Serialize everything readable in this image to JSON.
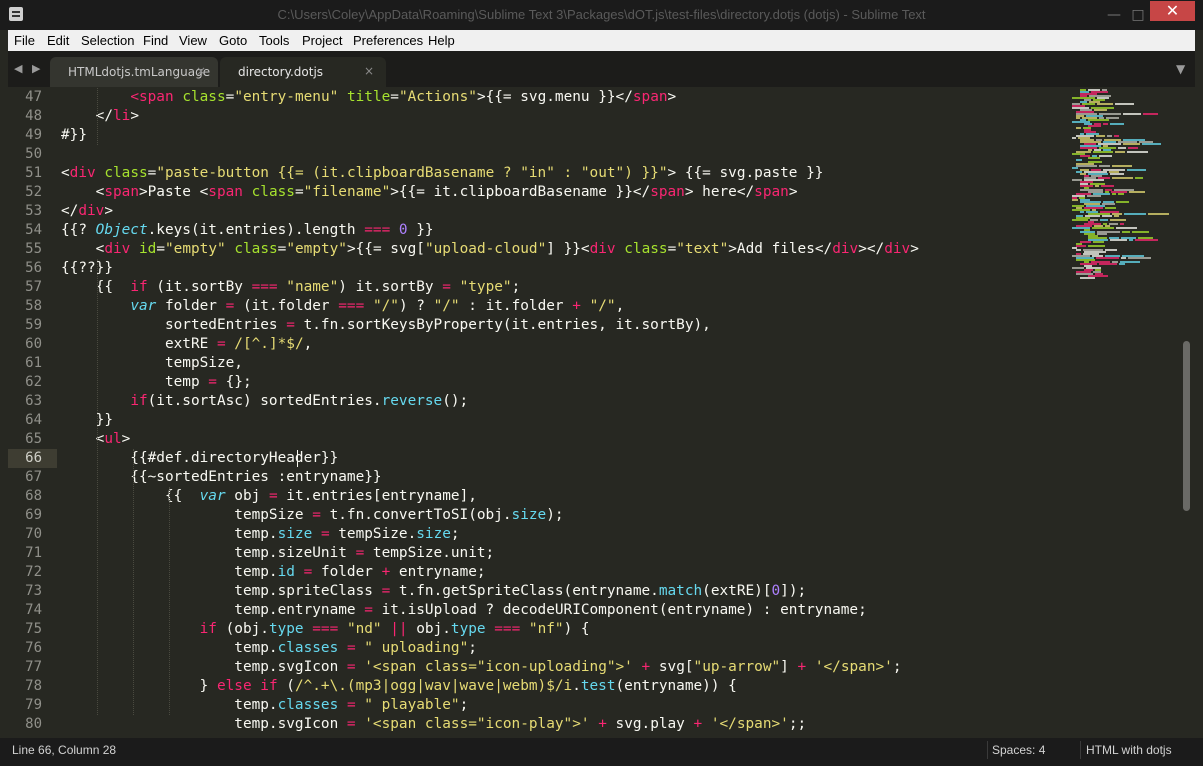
{
  "window": {
    "title": "C:\\Users\\Coley\\AppData\\Roaming\\Sublime Text 3\\Packages\\dOT.js\\test-files\\directory.dotjs (dotjs) - Sublime Text",
    "close_glyph": "✕",
    "min_glyph": "—",
    "max_glyph": "□"
  },
  "menu": [
    "File",
    "Edit",
    "Selection",
    "Find",
    "View",
    "Goto",
    "Tools",
    "Project",
    "Preferences",
    "Help"
  ],
  "tabs": [
    {
      "label": "HTMLdotjs.tmLanguage",
      "close": "×",
      "active": false
    },
    {
      "label": "directory.dotjs",
      "close": "×",
      "active": true
    }
  ],
  "tabbar": {
    "nav_left": "◀",
    "nav_right": "▶",
    "dropdown": "▼"
  },
  "editor": {
    "current_line": 66,
    "lines": [
      {
        "n": 47,
        "tokens": [
          [
            "        ",
            ""
          ],
          [
            "<",
            "tag"
          ],
          [
            "span",
            "tag"
          ],
          [
            " ",
            ""
          ],
          [
            "class",
            "attr"
          ],
          [
            "=",
            ""
          ],
          [
            "\"entry-menu\"",
            "str"
          ],
          [
            " ",
            ""
          ],
          [
            "title",
            "attr"
          ],
          [
            "=",
            ""
          ],
          [
            "\"Actions\"",
            "str"
          ],
          [
            ">{{= svg.menu }}</",
            ""
          ],
          [
            "span",
            "tag"
          ],
          [
            ">",
            ""
          ]
        ]
      },
      {
        "n": 48,
        "tokens": [
          [
            "    </",
            ""
          ],
          [
            "li",
            "tag"
          ],
          [
            ">",
            ""
          ]
        ]
      },
      {
        "n": 49,
        "tokens": [
          [
            "#}}",
            ""
          ]
        ]
      },
      {
        "n": 50,
        "tokens": [
          [
            "",
            ""
          ]
        ]
      },
      {
        "n": 51,
        "tokens": [
          [
            "<",
            ""
          ],
          [
            "div",
            "tag"
          ],
          [
            " ",
            ""
          ],
          [
            "class",
            "attr"
          ],
          [
            "=",
            ""
          ],
          [
            "\"paste-button {{= (it.clipboardBasename ? \"in\" : \"out\") }}\"",
            "str"
          ],
          [
            "> {{= svg.paste }}",
            ""
          ]
        ]
      },
      {
        "n": 52,
        "tokens": [
          [
            "    <",
            ""
          ],
          [
            "span",
            "tag"
          ],
          [
            ">Paste <",
            ""
          ],
          [
            "span",
            "tag"
          ],
          [
            " ",
            ""
          ],
          [
            "class",
            "attr"
          ],
          [
            "=",
            ""
          ],
          [
            "\"filename\"",
            "str"
          ],
          [
            ">{{= it.clipboardBasename }}</",
            ""
          ],
          [
            "span",
            "tag"
          ],
          [
            "> here</",
            ""
          ],
          [
            "span",
            "tag"
          ],
          [
            ">",
            ""
          ]
        ]
      },
      {
        "n": 53,
        "tokens": [
          [
            "</",
            ""
          ],
          [
            "div",
            "tag"
          ],
          [
            ">",
            ""
          ]
        ]
      },
      {
        "n": 54,
        "tokens": [
          [
            "{{? ",
            ""
          ],
          [
            "Object",
            "obj"
          ],
          [
            ".keys(it.entries).length ",
            ""
          ],
          [
            "===",
            "op"
          ],
          [
            " ",
            ""
          ],
          [
            "0",
            "num"
          ],
          [
            " }}",
            ""
          ]
        ]
      },
      {
        "n": 55,
        "tokens": [
          [
            "    <",
            ""
          ],
          [
            "div",
            "tag"
          ],
          [
            " ",
            ""
          ],
          [
            "id",
            "attr"
          ],
          [
            "=",
            ""
          ],
          [
            "\"empty\"",
            "str"
          ],
          [
            " ",
            ""
          ],
          [
            "class",
            "attr"
          ],
          [
            "=",
            ""
          ],
          [
            "\"empty\"",
            "str"
          ],
          [
            ">{{= svg[",
            ""
          ],
          [
            "\"upload-cloud\"",
            "str"
          ],
          [
            "] }}<",
            ""
          ],
          [
            "div",
            "tag"
          ],
          [
            " ",
            ""
          ],
          [
            "class",
            "attr"
          ],
          [
            "=",
            ""
          ],
          [
            "\"text\"",
            "str"
          ],
          [
            ">Add files</",
            ""
          ],
          [
            "div",
            "tag"
          ],
          [
            "></",
            ""
          ],
          [
            "div",
            "tag"
          ],
          [
            ">",
            ""
          ]
        ]
      },
      {
        "n": 56,
        "tokens": [
          [
            "{{??}}",
            ""
          ]
        ]
      },
      {
        "n": 57,
        "tokens": [
          [
            "    {{  ",
            ""
          ],
          [
            "if",
            "kw"
          ],
          [
            " (it.sortBy ",
            ""
          ],
          [
            "===",
            "op"
          ],
          [
            " ",
            ""
          ],
          [
            "\"name\"",
            "str"
          ],
          [
            ") it.sortBy ",
            ""
          ],
          [
            "=",
            "op"
          ],
          [
            " ",
            ""
          ],
          [
            "\"type\"",
            "str"
          ],
          [
            ";",
            ""
          ]
        ]
      },
      {
        "n": 58,
        "tokens": [
          [
            "        ",
            ""
          ],
          [
            "var",
            "obj"
          ],
          [
            " folder ",
            ""
          ],
          [
            "=",
            "op"
          ],
          [
            " (it.folder ",
            ""
          ],
          [
            "===",
            "op"
          ],
          [
            " ",
            ""
          ],
          [
            "\"/\"",
            "str"
          ],
          [
            ") ? ",
            ""
          ],
          [
            "\"/\"",
            "str"
          ],
          [
            " : it.folder ",
            ""
          ],
          [
            "+",
            "op"
          ],
          [
            " ",
            ""
          ],
          [
            "\"/\"",
            "str"
          ],
          [
            ",",
            ""
          ]
        ]
      },
      {
        "n": 59,
        "tokens": [
          [
            "            sortedEntries ",
            ""
          ],
          [
            "=",
            "op"
          ],
          [
            " t.fn.sortKeysByProperty(it.entries, it.sortBy),",
            ""
          ]
        ]
      },
      {
        "n": 60,
        "tokens": [
          [
            "            extRE ",
            ""
          ],
          [
            "=",
            "op"
          ],
          [
            " ",
            ""
          ],
          [
            "/[^.]*$/",
            "str"
          ],
          [
            ",",
            ""
          ]
        ]
      },
      {
        "n": 61,
        "tokens": [
          [
            "            tempSize,",
            ""
          ]
        ]
      },
      {
        "n": 62,
        "tokens": [
          [
            "            temp ",
            ""
          ],
          [
            "=",
            "op"
          ],
          [
            " {};",
            ""
          ]
        ]
      },
      {
        "n": 63,
        "tokens": [
          [
            "        ",
            ""
          ],
          [
            "if",
            "kw"
          ],
          [
            "(it.sortAsc) sortedEntries.",
            ""
          ],
          [
            "reverse",
            "fn"
          ],
          [
            "();",
            ""
          ]
        ]
      },
      {
        "n": 64,
        "tokens": [
          [
            "    }}",
            ""
          ]
        ]
      },
      {
        "n": 65,
        "tokens": [
          [
            "    <",
            ""
          ],
          [
            "ul",
            "tag"
          ],
          [
            ">",
            ""
          ]
        ]
      },
      {
        "n": 66,
        "tokens": [
          [
            "        {{#def.directoryHeader}}",
            ""
          ]
        ]
      },
      {
        "n": 67,
        "tokens": [
          [
            "        {{~sortedEntries :entryname}}",
            ""
          ]
        ]
      },
      {
        "n": 68,
        "tokens": [
          [
            "            {{  ",
            ""
          ],
          [
            "var",
            "obj"
          ],
          [
            " obj ",
            ""
          ],
          [
            "=",
            "op"
          ],
          [
            " it.entries[entryname],",
            ""
          ]
        ]
      },
      {
        "n": 69,
        "tokens": [
          [
            "                    tempSize ",
            ""
          ],
          [
            "=",
            "op"
          ],
          [
            " t.fn.convertToSI(obj.",
            ""
          ],
          [
            "size",
            "fn"
          ],
          [
            ");",
            ""
          ]
        ]
      },
      {
        "n": 70,
        "tokens": [
          [
            "                    temp.",
            ""
          ],
          [
            "size",
            "fn"
          ],
          [
            " ",
            ""
          ],
          [
            "=",
            "op"
          ],
          [
            " tempSize.",
            ""
          ],
          [
            "size",
            "fn"
          ],
          [
            ";",
            ""
          ]
        ]
      },
      {
        "n": 71,
        "tokens": [
          [
            "                    temp.sizeUnit ",
            ""
          ],
          [
            "=",
            "op"
          ],
          [
            " tempSize.unit;",
            ""
          ]
        ]
      },
      {
        "n": 72,
        "tokens": [
          [
            "                    temp.",
            ""
          ],
          [
            "id",
            "fn"
          ],
          [
            " ",
            ""
          ],
          [
            "=",
            "op"
          ],
          [
            " folder ",
            ""
          ],
          [
            "+",
            "op"
          ],
          [
            " entryname;",
            ""
          ]
        ]
      },
      {
        "n": 73,
        "tokens": [
          [
            "                    temp.spriteClass ",
            ""
          ],
          [
            "=",
            "op"
          ],
          [
            " t.fn.getSpriteClass(entryname.",
            ""
          ],
          [
            "match",
            "fn"
          ],
          [
            "(extRE)[",
            ""
          ],
          [
            "0",
            "num"
          ],
          [
            "]);",
            ""
          ]
        ]
      },
      {
        "n": 74,
        "tokens": [
          [
            "                    temp.entryname ",
            ""
          ],
          [
            "=",
            "op"
          ],
          [
            " it.isUpload ? decodeURIComponent(entryname) : entryname;",
            ""
          ]
        ]
      },
      {
        "n": 75,
        "tokens": [
          [
            "                ",
            ""
          ],
          [
            "if",
            "kw"
          ],
          [
            " (obj.",
            ""
          ],
          [
            "type",
            "fn"
          ],
          [
            " ",
            ""
          ],
          [
            "===",
            "op"
          ],
          [
            " ",
            ""
          ],
          [
            "\"nd\"",
            "str"
          ],
          [
            " ",
            ""
          ],
          [
            "||",
            "op"
          ],
          [
            " obj.",
            ""
          ],
          [
            "type",
            "fn"
          ],
          [
            " ",
            ""
          ],
          [
            "===",
            "op"
          ],
          [
            " ",
            ""
          ],
          [
            "\"nf\"",
            "str"
          ],
          [
            ") {",
            ""
          ]
        ]
      },
      {
        "n": 76,
        "tokens": [
          [
            "                    temp.",
            ""
          ],
          [
            "classes",
            "fn"
          ],
          [
            " ",
            ""
          ],
          [
            "=",
            "op"
          ],
          [
            " ",
            ""
          ],
          [
            "\" uploading\"",
            "str"
          ],
          [
            ";",
            ""
          ]
        ]
      },
      {
        "n": 77,
        "tokens": [
          [
            "                    temp.svgIcon ",
            ""
          ],
          [
            "=",
            "op"
          ],
          [
            " ",
            ""
          ],
          [
            "'<span class=\"icon-uploading\">'",
            "str"
          ],
          [
            " ",
            ""
          ],
          [
            "+",
            "op"
          ],
          [
            " svg[",
            ""
          ],
          [
            "\"up-arrow\"",
            "str"
          ],
          [
            "] ",
            ""
          ],
          [
            "+",
            "op"
          ],
          [
            " ",
            ""
          ],
          [
            "'</span>'",
            "str"
          ],
          [
            ";",
            ""
          ]
        ]
      },
      {
        "n": 78,
        "tokens": [
          [
            "                } ",
            ""
          ],
          [
            "else",
            "kw"
          ],
          [
            " ",
            ""
          ],
          [
            "if",
            "kw"
          ],
          [
            " (",
            ""
          ],
          [
            "/^.+\\.(mp3|ogg|wav|wave|webm)$/i",
            "str"
          ],
          [
            ".",
            ""
          ],
          [
            "test",
            "fn"
          ],
          [
            "(entryname)) {",
            ""
          ]
        ]
      },
      {
        "n": 79,
        "tokens": [
          [
            "                    temp.",
            ""
          ],
          [
            "classes",
            "fn"
          ],
          [
            " ",
            ""
          ],
          [
            "=",
            "op"
          ],
          [
            " ",
            ""
          ],
          [
            "\" playable\"",
            "str"
          ],
          [
            ";",
            ""
          ]
        ]
      },
      {
        "n": 80,
        "tokens": [
          [
            "                    temp.svgIcon ",
            ""
          ],
          [
            "=",
            "op"
          ],
          [
            " ",
            ""
          ],
          [
            "'<span class=\"icon-play\">'",
            "str"
          ],
          [
            " ",
            ""
          ],
          [
            "+",
            "op"
          ],
          [
            " svg.play ",
            ""
          ],
          [
            "+",
            "op"
          ],
          [
            " ",
            ""
          ],
          [
            "'</span>'",
            "str"
          ],
          [
            ";;",
            ""
          ]
        ]
      }
    ]
  },
  "status": {
    "position": "Line 66, Column 28",
    "spaces": "Spaces: 4",
    "syntax": "HTML with dotjs"
  },
  "colors": {
    "background": "#272822",
    "keyword": "#f92672",
    "attribute": "#a6e22e",
    "string": "#e6db74",
    "number": "#ae81ff",
    "function": "#66d9ef",
    "close_button": "#c74646"
  }
}
